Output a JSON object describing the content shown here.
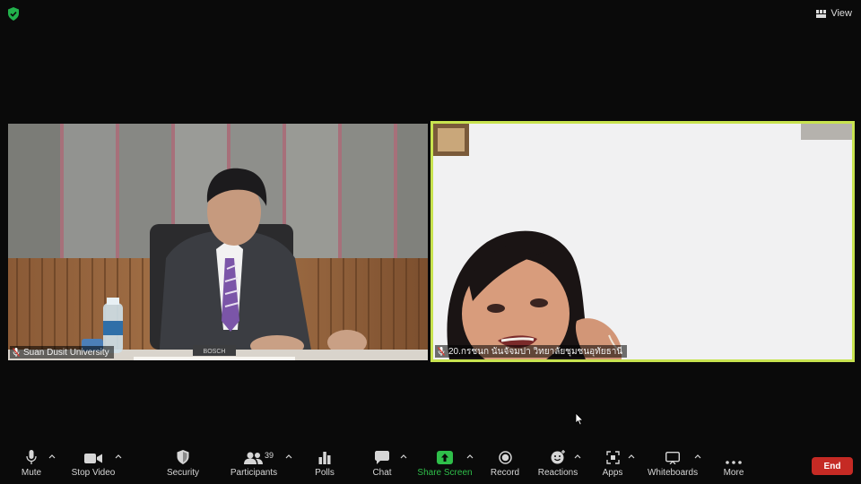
{
  "top_bar": {
    "view_label": "View"
  },
  "participants_video": [
    {
      "name": "Suan Dusit University",
      "muted": true
    },
    {
      "name": "20.กรชนก นันจัจมปา วิทยาลัยชุมชนอุทัยธานี",
      "muted": true,
      "active_speaker": true
    }
  ],
  "toolbar": {
    "mute": "Mute",
    "stop_video": "Stop Video",
    "security": "Security",
    "participants": "Participants",
    "participants_count": "39",
    "polls": "Polls",
    "chat": "Chat",
    "share_screen": "Share Screen",
    "record": "Record",
    "reactions": "Reactions",
    "apps": "Apps",
    "whiteboards": "Whiteboards",
    "more": "More",
    "end": "End"
  },
  "colors": {
    "active_speaker_border": "#c8e34f",
    "share_screen_green": "#2fbf4a",
    "end_red": "#c52a24",
    "security_shield": "#22b14c"
  }
}
